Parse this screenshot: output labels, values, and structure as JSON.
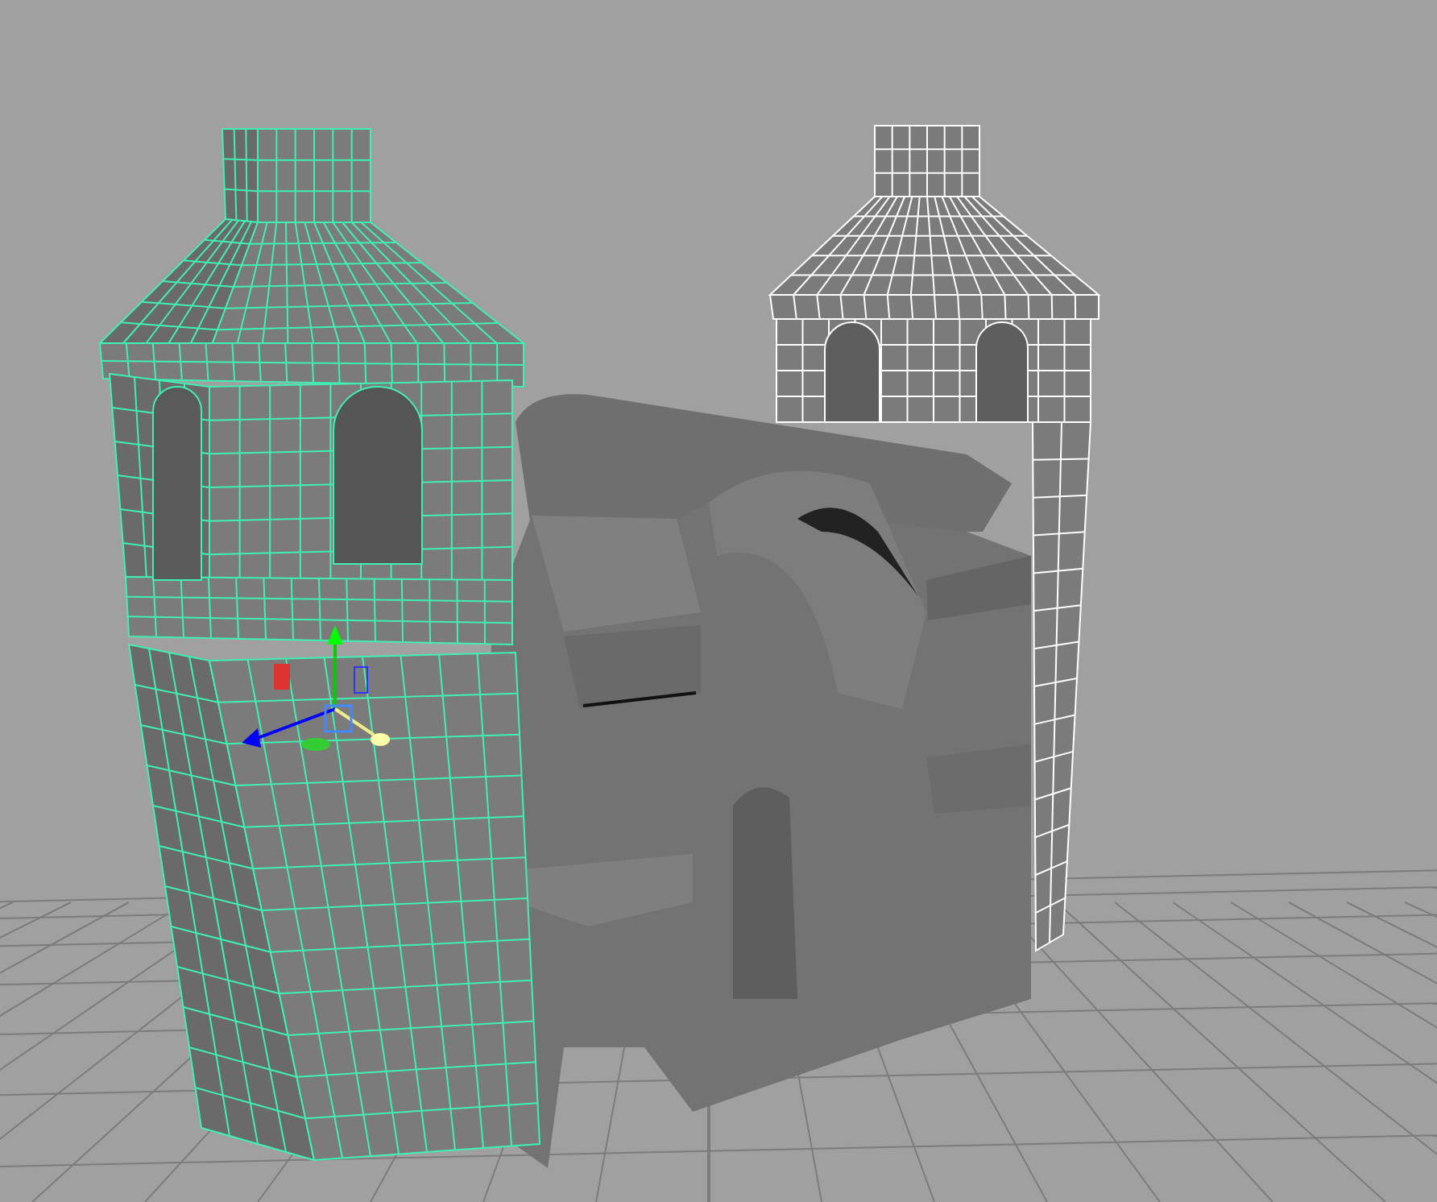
{
  "viewport": {
    "objects": [
      {
        "kind": "tower-right",
        "selected": false,
        "wireframe": true
      },
      {
        "kind": "facade",
        "selected": false,
        "wireframe": false
      },
      {
        "kind": "tower-left",
        "selected": true,
        "wireframe": true
      }
    ]
  }
}
